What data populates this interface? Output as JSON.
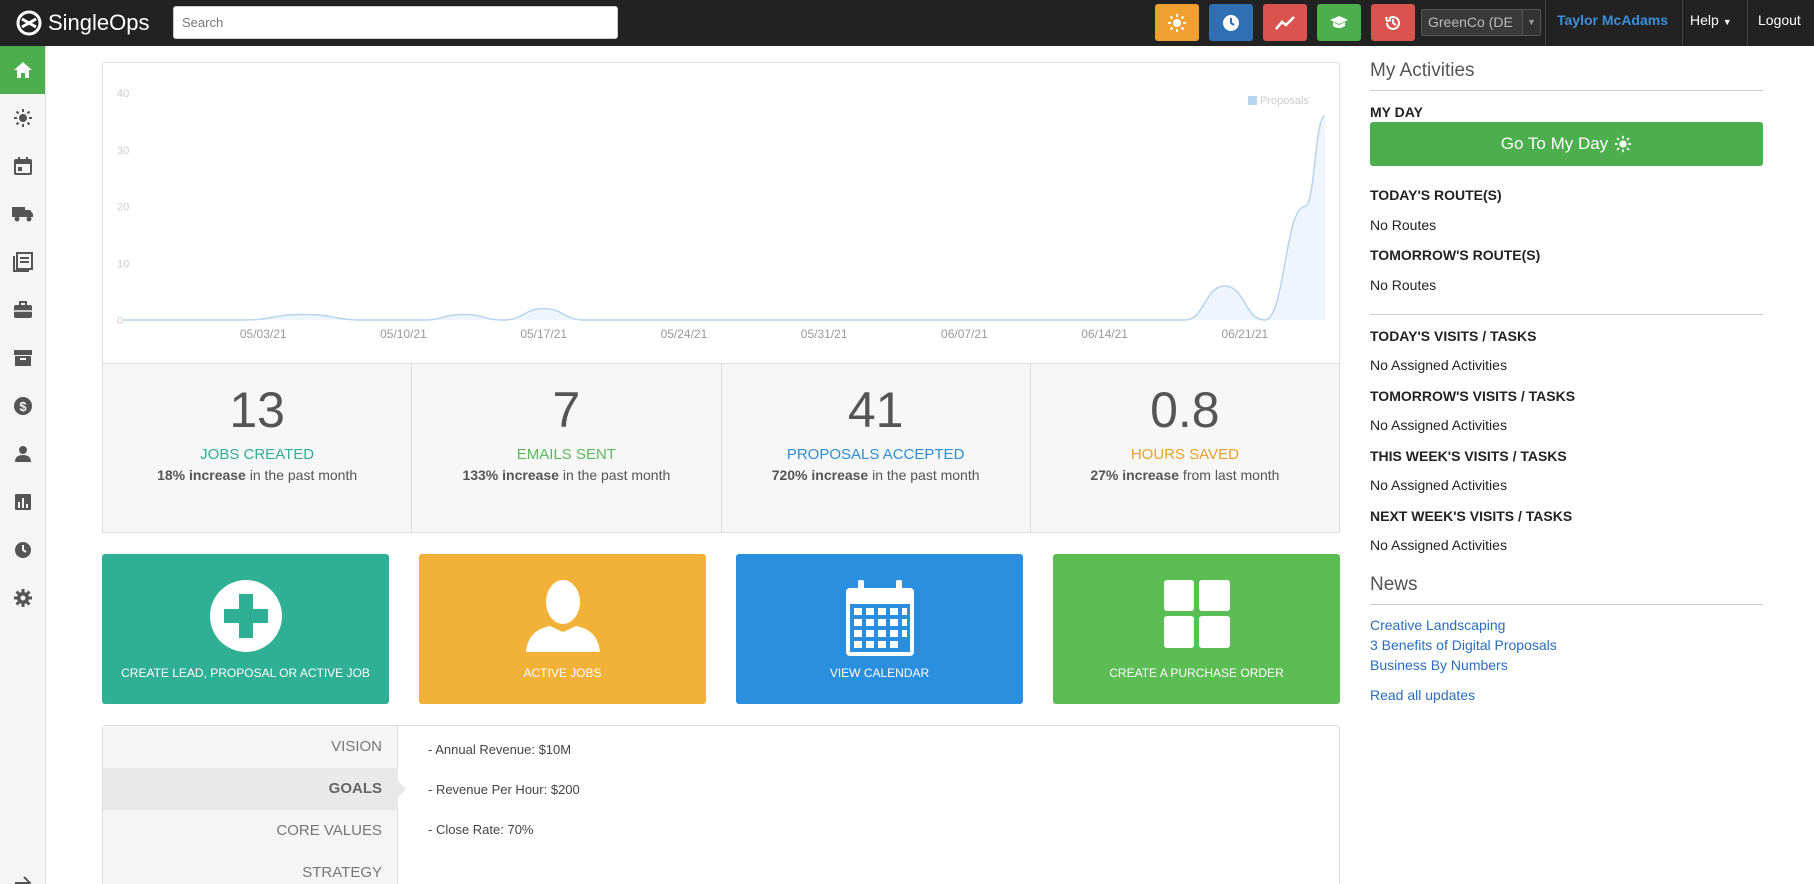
{
  "header": {
    "app_name": "SingleOps",
    "search_placeholder": "Search",
    "quick_buttons": [
      {
        "icon": "sun-icon",
        "color": "#f0a030"
      },
      {
        "icon": "clock-icon",
        "color": "#2f6fb4"
      },
      {
        "icon": "trend-icon",
        "color": "#d9534f"
      },
      {
        "icon": "graduation-cap-icon",
        "color": "#4cae4c"
      },
      {
        "icon": "history-icon",
        "color": "#d9534f"
      }
    ],
    "company_select": "GreenCo (DE",
    "user_name": "Taylor McAdams",
    "help_label": "Help",
    "logout_label": "Logout"
  },
  "sidebar": {
    "items": [
      "home-icon",
      "sun-icon",
      "calendar-icon",
      "truck-icon",
      "list-icon",
      "briefcase-icon",
      "archive-icon",
      "dollar-icon",
      "person-icon",
      "bar-chart-icon",
      "clock-icon",
      "gear-icon"
    ],
    "expand_icon": "arrow-right-icon"
  },
  "chart_data": {
    "type": "area",
    "legend": [
      "Proposals"
    ],
    "legend_position": "top-right",
    "ylim": [
      0,
      40
    ],
    "y_ticks": [
      "0",
      "10",
      "20",
      "30",
      "40"
    ],
    "x_ticks": [
      "05/03/21",
      "05/10/21",
      "05/17/21",
      "05/24/21",
      "05/31/21",
      "06/07/21",
      "06/14/21",
      "06/21/21"
    ],
    "series": [
      {
        "name": "Proposals",
        "color": "#b8d4ee",
        "x": [
          "04/26/21",
          "04/29/21",
          "05/02/21",
          "05/05/21",
          "05/08/21",
          "05/11/21",
          "05/13/21",
          "05/15/21",
          "05/17/21",
          "05/19/21",
          "05/22/21",
          "06/14/21",
          "06/18/21",
          "06/20/21",
          "06/22/21",
          "06/24/21",
          "06/25/21"
        ],
        "values": [
          0,
          0,
          0,
          1,
          0,
          0,
          1,
          0,
          2,
          0,
          0,
          0,
          0,
          6,
          0,
          20,
          36
        ]
      }
    ]
  },
  "stats": [
    {
      "number": "13",
      "label": "JOBS CREATED",
      "color": "#2fb094",
      "bold": "18% increase",
      "rest": " in the past month"
    },
    {
      "number": "7",
      "label": "EMAILS SENT",
      "color": "#5cb85c",
      "bold": "133% increase",
      "rest": " in the past month"
    },
    {
      "number": "41",
      "label": "PROPOSALS ACCEPTED",
      "color": "#2b8fd4",
      "bold": "720% increase",
      "rest": " in the past month"
    },
    {
      "number": "0.8",
      "label": "HOURS SAVED",
      "color": "#e8a02a",
      "bold": "27% increase",
      "rest": " from last month"
    }
  ],
  "tiles": [
    {
      "label": "CREATE LEAD, PROPOSAL OR ACTIVE JOB",
      "color": "#2fb094",
      "icon": "plus-circle-icon"
    },
    {
      "label": "ACTIVE JOBS",
      "color": "#f2b138",
      "icon": "user-icon"
    },
    {
      "label": "VIEW CALENDAR",
      "color": "#2b8fe0",
      "icon": "calendar-icon"
    },
    {
      "label": "CREATE A PURCHASE ORDER",
      "color": "#5dbd55",
      "icon": "grid-icon"
    }
  ],
  "vision_panel": {
    "tabs": [
      "VISION",
      "GOALS",
      "CORE VALUES",
      "STRATEGY"
    ],
    "active_tab": "GOALS",
    "goals": [
      "- Annual Revenue: $10M",
      "- Revenue Per Hour: $200",
      "- Close Rate: 70%"
    ]
  },
  "activities": {
    "title": "My Activities",
    "my_day_heading": "MY DAY",
    "my_day_button": "Go To My Day",
    "sections": [
      {
        "heading": "TODAY'S ROUTE(S)",
        "text": "No Routes"
      },
      {
        "heading": "TOMORROW'S ROUTE(S)",
        "text": "No Routes"
      },
      {
        "heading": "TODAY'S VISITS / TASKS",
        "text": "No Assigned Activities"
      },
      {
        "heading": "TOMORROW'S VISITS / TASKS",
        "text": "No Assigned Activities"
      },
      {
        "heading": "THIS WEEK'S VISITS / TASKS",
        "text": "No Assigned Activities"
      },
      {
        "heading": "NEXT WEEK'S VISITS / TASKS",
        "text": "No Assigned Activities"
      }
    ]
  },
  "news": {
    "title": "News",
    "links": [
      "Creative Landscaping",
      "3 Benefits of Digital Proposals",
      "Business By Numbers"
    ],
    "read_all": "Read all updates"
  }
}
